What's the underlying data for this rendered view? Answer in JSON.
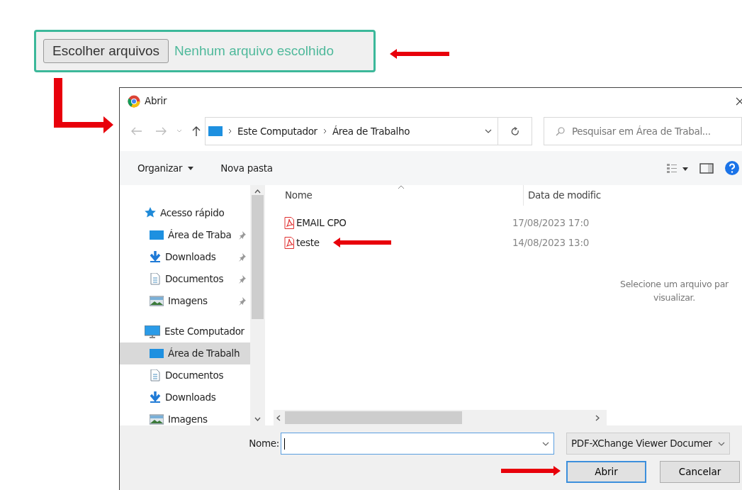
{
  "file_input": {
    "button": "Escolher arquivos",
    "status": "Nenhum arquivo escolhido"
  },
  "dialog": {
    "title": "Abrir",
    "address": {
      "path": [
        "Este Computador",
        "Área de Trabalho"
      ]
    },
    "search": {
      "placeholder": "Pesquisar em Área de Trabal..."
    },
    "toolbar": [
      {
        "label": "Organizar",
        "dropdown": true
      },
      {
        "label": "Nova pasta",
        "dropdown": false
      }
    ],
    "nav": [
      {
        "label": "Acesso rápido",
        "kind": "star",
        "selected": false,
        "children": [
          {
            "label": "Área de Traba",
            "kind": "desktop",
            "pinned": true,
            "selected": false
          },
          {
            "label": "Downloads",
            "kind": "download",
            "pinned": true,
            "selected": false
          },
          {
            "label": "Documentos",
            "kind": "document",
            "pinned": true,
            "selected": false
          },
          {
            "label": "Imagens",
            "kind": "pictures",
            "pinned": true,
            "selected": false
          }
        ]
      },
      {
        "label": "Este Computador",
        "kind": "computer",
        "selected": false,
        "children": [
          {
            "label": "Área de Trabalh",
            "kind": "desktop",
            "pinned": false,
            "selected": true
          },
          {
            "label": "Documentos",
            "kind": "document",
            "pinned": false,
            "selected": false
          },
          {
            "label": "Downloads",
            "kind": "download",
            "pinned": false,
            "selected": false
          },
          {
            "label": "Imagens",
            "kind": "pictures",
            "pinned": false,
            "selected": false
          }
        ]
      }
    ],
    "columns": [
      "Nome",
      "Data de modific"
    ],
    "files": [
      {
        "name": "EMAIL CPO",
        "date": "17/08/2023 17:0",
        "selected": false
      },
      {
        "name": "teste",
        "date": "14/08/2023 13:0",
        "selected": false
      }
    ],
    "preview": [
      "Selecione um arquivo par",
      "visualizar."
    ],
    "filename_label": "Nome:",
    "filetype": "PDF-XChange Viewer Documer",
    "buttons": [
      {
        "label": "Abrir",
        "default": true
      },
      {
        "label": "Cancelar",
        "default": false
      }
    ]
  }
}
